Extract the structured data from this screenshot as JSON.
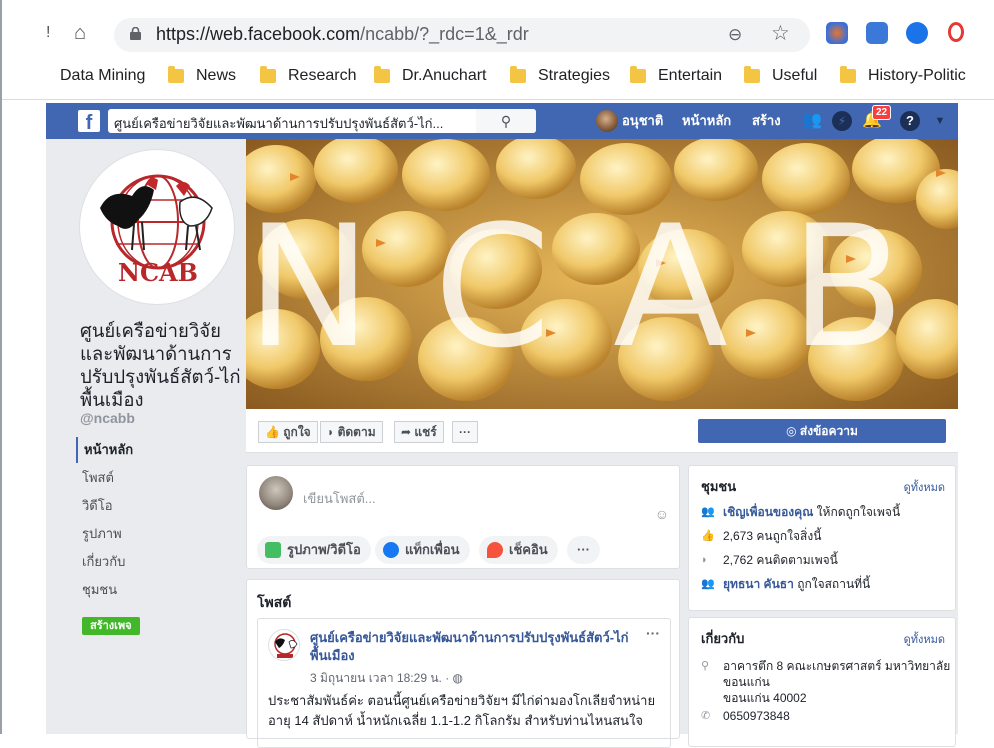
{
  "browser": {
    "url_host": "https://web.facebook.com",
    "url_path": "/ncabb/?_rdc=1&_rdr",
    "bookmarks": [
      "Data Mining",
      "News",
      "Research",
      "Dr.Anuchart",
      "Strategies",
      "Entertain",
      "Useful",
      "History-Politic"
    ]
  },
  "fb_header": {
    "search_text": "ศูนย์เครือข่ายวิจัยและพัฒนาด้านการปรับปรุงพันธ์สัตว์-ไก่...",
    "user_name": "อนุชาติ",
    "home_label": "หน้าหลัก",
    "create_label": "สร้าง",
    "notif_count": "22"
  },
  "page_info": {
    "name": "ศูนย์เครือข่ายวิจัยและพัฒนาด้านการปรับปรุงพันธ์สัตว์-ไก่พื้นเมือง",
    "handle": "@ncabb",
    "logo_text": "NCAB",
    "cover_text": "NCAB"
  },
  "left_nav": {
    "items": [
      "หน้าหลัก",
      "โพสต์",
      "วิดีโอ",
      "รูปภาพ",
      "เกี่ยวกับ",
      "ชุมชน"
    ],
    "create_page": "สร้างเพจ"
  },
  "actions": {
    "like": "ถูกใจ",
    "follow": "ติดตาม",
    "share": "แชร์",
    "more": "···",
    "send_message": "ส่งข้อความ"
  },
  "composer": {
    "placeholder": "เขียนโพสต์...",
    "photo_video": "รูปภาพ/วิดีโอ",
    "tag_friends": "แท็กเพื่อน",
    "check_in": "เช็คอิน",
    "more": "···"
  },
  "posts": {
    "section_title": "โพสต์",
    "author": "ศูนย์เครือข่ายวิจัยและพัฒนาด้านการปรับปรุงพันธ์สัตว์-ไก่พื้นเมือง",
    "meta": "3 มิถุนายน เวลา 18:29 น. · ◍",
    "body": "ประชาสัมพันธ์ค่ะ ตอนนี้ศูนย์เครือข่ายวิจัยฯ มีไก่ด่ามองโกเลียจำหน่าย อายุ 14 สัปดาห์ น้ำหนักเฉลี่ย 1.1-1.2 กิโลกรัม สำหรับท่านไหนสนใจ"
  },
  "community": {
    "title": "ชุมชน",
    "see_all": "ดูทั้งหมด",
    "invite": "เชิญเพื่อนของคุณ",
    "invite_rest": "ให้กดถูกใจเพจนี้",
    "likes": "2,673 คนถูกใจสิ่งนี้",
    "follows": "2,762 คนติดตามเพจนี้",
    "friend_name": "ยุทธนา คันธา",
    "friend_rest": "ถูกใจสถานที่นี้"
  },
  "about": {
    "title": "เกี่ยวกับ",
    "see_all": "ดูทั้งหมด",
    "address_line1": "อาคารตึก 8 คณะเกษตรศาสตร์ มหาวิทยาลัยขอนแก่น",
    "address_line2": "ขอนแก่น 40002",
    "phone": "0650973848"
  }
}
